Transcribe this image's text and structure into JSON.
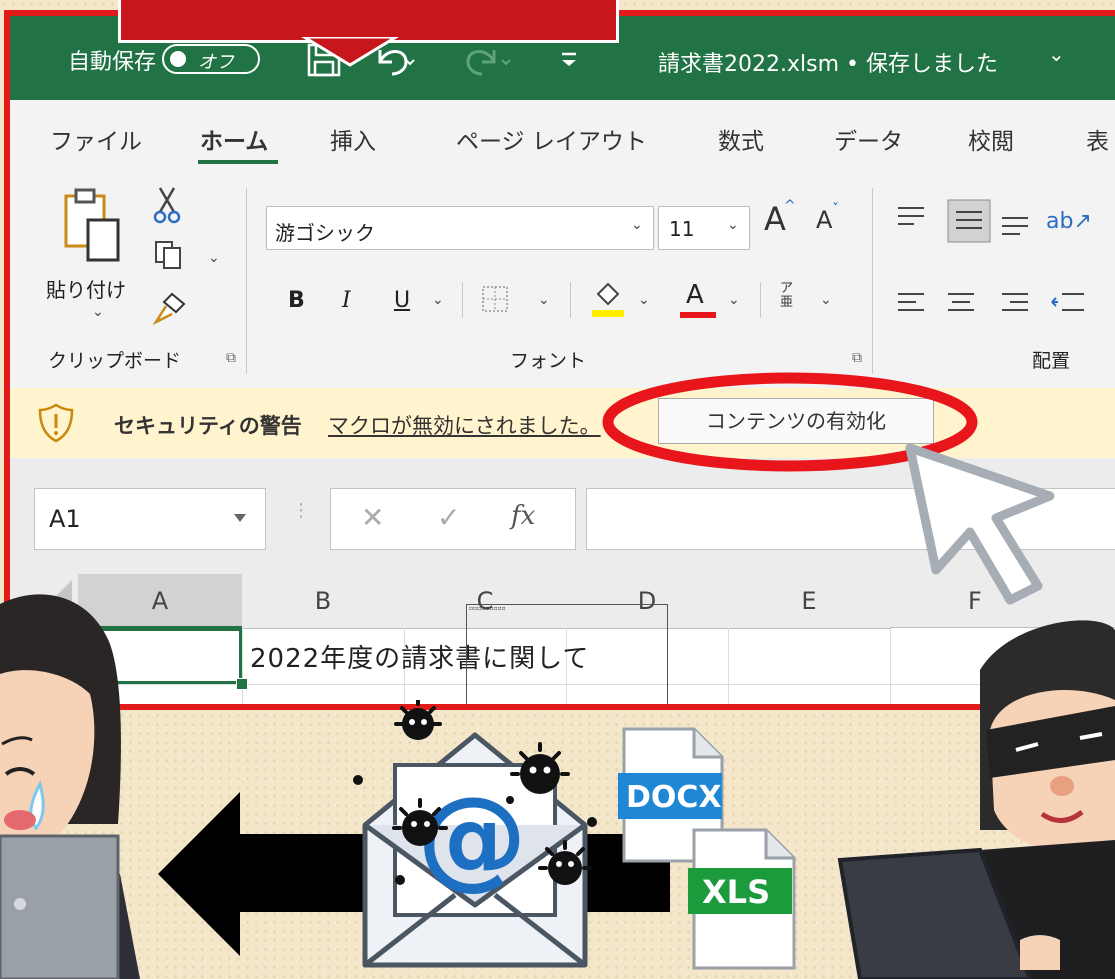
{
  "excel": {
    "title": {
      "autosave_label": "自動保存",
      "autosave_toggle": "オフ",
      "filename": "請求書2022.xlsm • 保存しました",
      "filename_caret": "⌄"
    },
    "tabs": [
      "ファイル",
      "ホーム",
      "挿入",
      "ページ レイアウト",
      "数式",
      "データ",
      "校閲",
      "表"
    ],
    "ribbon": {
      "paste_label": "貼り付け",
      "clipboard_group": "クリップボード",
      "font_name": "游ゴシック",
      "font_size": "11",
      "font_group": "フォント",
      "align_group": "配置",
      "bold": "B",
      "italic": "I",
      "underline": "U",
      "grow_font": "A",
      "shrink_font": "A",
      "phonetic": "ア亜",
      "font_color_letter": "A"
    },
    "security": {
      "title": "セキュリティの警告",
      "message": "マクロが無効にされました。",
      "button": "コンテンツの有効化"
    },
    "formula_bar": {
      "name_box": "A1",
      "fx": "fx"
    },
    "grid": {
      "columns": [
        "A",
        "B",
        "C",
        "D",
        "E",
        "F"
      ],
      "cell_b1": "2022年度の請求書に関して"
    }
  },
  "attachments": {
    "docx": "DOCX",
    "xls": "XLS",
    "email_symbol": "@"
  },
  "colors": {
    "excel_green": "#217346",
    "frame_red": "#e21a1a",
    "highlight_red": "#e8151b",
    "docx_blue": "#1e88d6",
    "xls_green": "#1c9b3d",
    "warning_bg": "#fff4ce"
  },
  "icons": [
    "paste-icon",
    "cut-icon",
    "copy-icon",
    "format-painter-icon",
    "save-icon",
    "undo-icon",
    "redo-icon",
    "warning-shield-icon",
    "cursor-arrow-icon",
    "email-envelope-icon",
    "virus-icon",
    "arrow-left-icon"
  ]
}
